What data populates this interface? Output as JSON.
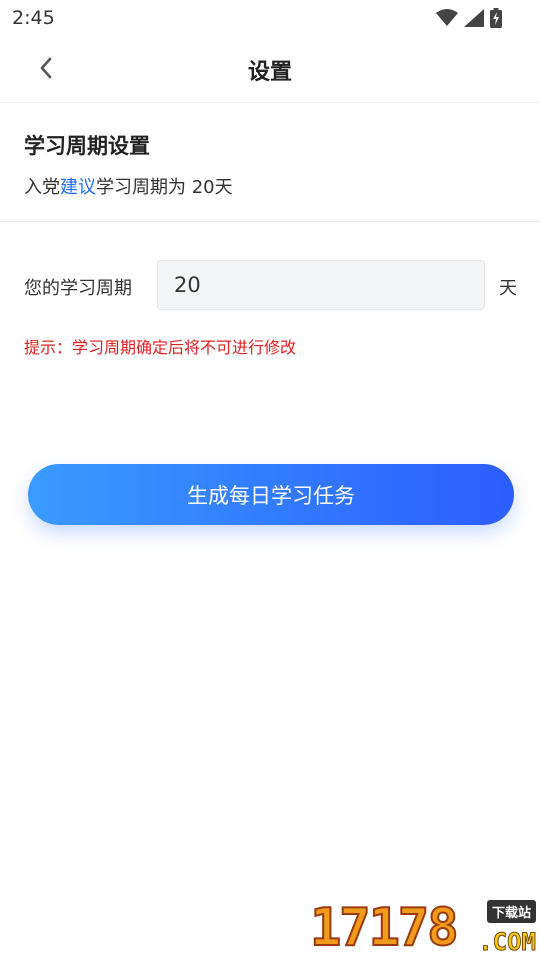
{
  "status_bar": {
    "time": "2:45",
    "icons": [
      "wifi-icon",
      "signal-icon",
      "battery-charging-icon"
    ]
  },
  "header": {
    "back_icon": "chevron-left-icon",
    "title": "设置"
  },
  "intro": {
    "title": "学习周期设置",
    "desc_prefix": "入党",
    "desc_link": "建议",
    "desc_suffix": "学习周期为 20天"
  },
  "form": {
    "period_label": "您的学习周期",
    "period_value": "20",
    "unit": "天",
    "hint": "提示：学习周期确定后将不可进行修改"
  },
  "actions": {
    "generate_label": "生成每日学习任务"
  },
  "watermark": {
    "digits": "17178",
    "badge": "下载站",
    "suffix": ".COM"
  },
  "colors": {
    "accent": "#1f6fff",
    "hint": "#e02020",
    "button_start": "#3a9bff",
    "button_end": "#2b5dff"
  }
}
